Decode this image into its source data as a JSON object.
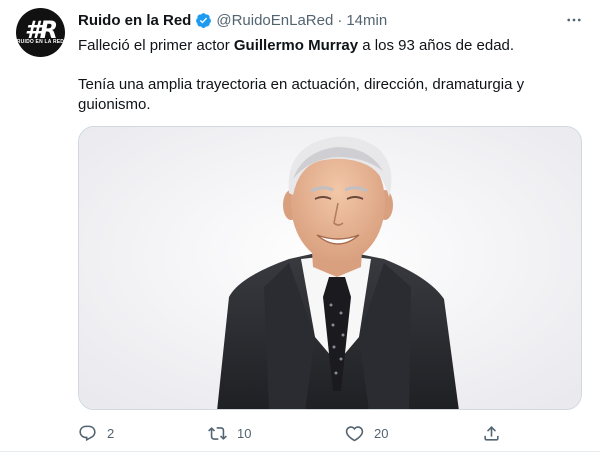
{
  "tweet": {
    "author": {
      "name": "Ruido en la Red",
      "handle": "@RuidoEnLaRed",
      "verified": true,
      "avatar_text": "#R",
      "avatar_subtext": "RUIDO EN LA RED"
    },
    "separator": "·",
    "time": "14min",
    "more_icon": "more-horizontal-icon",
    "text": {
      "line1_prefix": "Falleció el primer actor ",
      "line1_bold": "Guillermo Murray",
      "line1_suffix": " a los 93 años de edad.",
      "paragraph2": "Tenía una amplia trayectoria en actuación, dirección, dramaturgia y guionismo."
    },
    "actions": {
      "reply_count": "2",
      "retweet_count": "10",
      "like_count": "20"
    }
  },
  "colors": {
    "text_primary": "#0f1419",
    "text_secondary": "#536471",
    "verified_blue": "#1d9bf0",
    "border": "#cfd9de"
  }
}
